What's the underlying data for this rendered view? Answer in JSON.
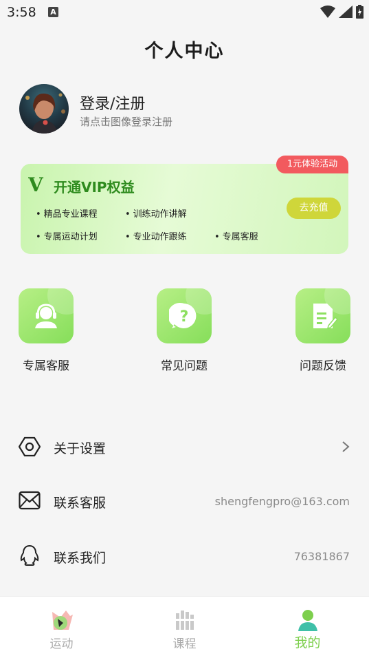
{
  "status_bar": {
    "time": "3:58",
    "notification": "A"
  },
  "page_title": "个人中心",
  "profile": {
    "title": "登录/注册",
    "subtitle": "请点击图像登录注册"
  },
  "vip": {
    "badge": "1元体验活动",
    "logo_letter": "V",
    "title": "开通VIP权益",
    "benefits": [
      "精品专业课程",
      "训练动作讲解",
      "专属运动计划",
      "专业动作跟练",
      "专属客服"
    ],
    "button": "去充值",
    "accent": "#2e8b1e"
  },
  "services": [
    {
      "label": "专属客服",
      "icon": "headset-icon"
    },
    {
      "label": "常见问题",
      "icon": "question-icon"
    },
    {
      "label": "问题反馈",
      "icon": "feedback-icon"
    }
  ],
  "menu": [
    {
      "label": "关于设置",
      "value": "",
      "icon": "settings-hex-icon"
    },
    {
      "label": "联系客服",
      "value": "shengfengpro@163.com",
      "icon": "mail-icon"
    },
    {
      "label": "联系我们",
      "value": "76381867",
      "icon": "qq-icon"
    }
  ],
  "bottom_nav": [
    {
      "label": "运动",
      "icon": "sport-icon",
      "active": false
    },
    {
      "label": "课程",
      "icon": "course-icon",
      "active": false
    },
    {
      "label": "我的",
      "icon": "profile-icon",
      "active": true
    }
  ],
  "colors": {
    "brand_green": "#7dcf4d",
    "badge_red": "#f25a5e",
    "recharge": "#cfd63a"
  }
}
